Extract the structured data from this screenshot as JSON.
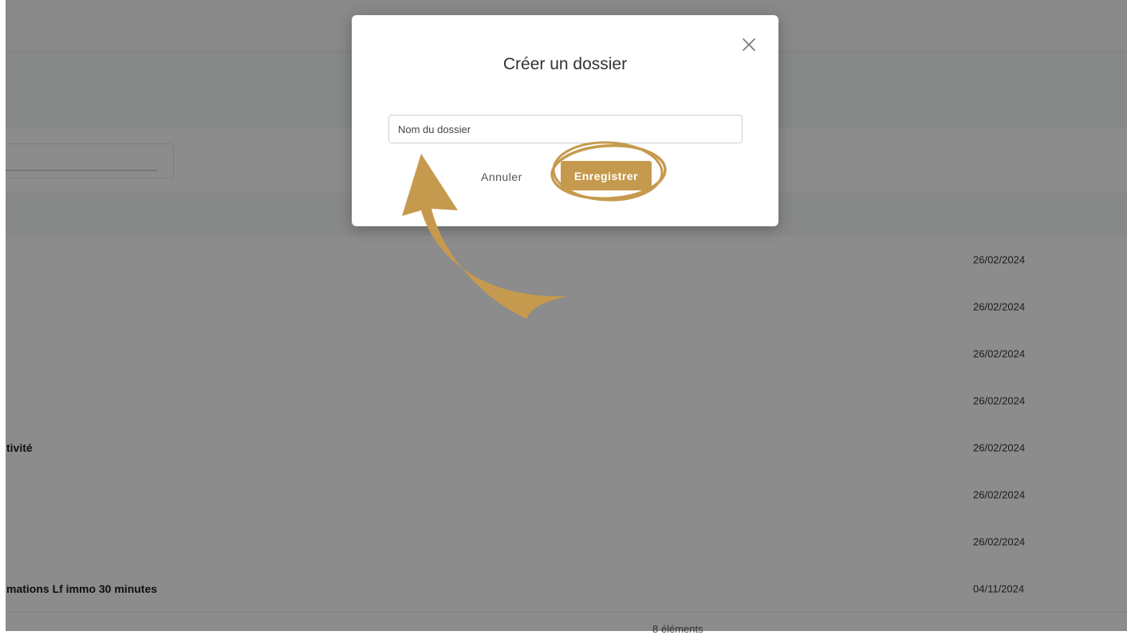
{
  "modal": {
    "title": "Créer un dossier",
    "input_placeholder": "Nom du dossier",
    "input_value": "",
    "cancel_label": "Annuler",
    "save_label": "Enregistrer"
  },
  "table": {
    "rows": [
      {
        "name": "",
        "date": "26/02/2024"
      },
      {
        "name": "",
        "date": "26/02/2024"
      },
      {
        "name": "",
        "date": "26/02/2024"
      },
      {
        "name": "",
        "date": "26/02/2024"
      },
      {
        "name": "tivité",
        "date": "26/02/2024"
      },
      {
        "name": "",
        "date": "26/02/2024"
      },
      {
        "name": "",
        "date": "26/02/2024"
      },
      {
        "name": "mations Lf immo 30 minutes",
        "date": "04/11/2024"
      }
    ],
    "footer_count": "8 éléments"
  },
  "annotation": {
    "color": "#c69a4e",
    "arrow_icon": "curved-arrow-icon",
    "highlight_icon": "highlight-circle-icon"
  }
}
